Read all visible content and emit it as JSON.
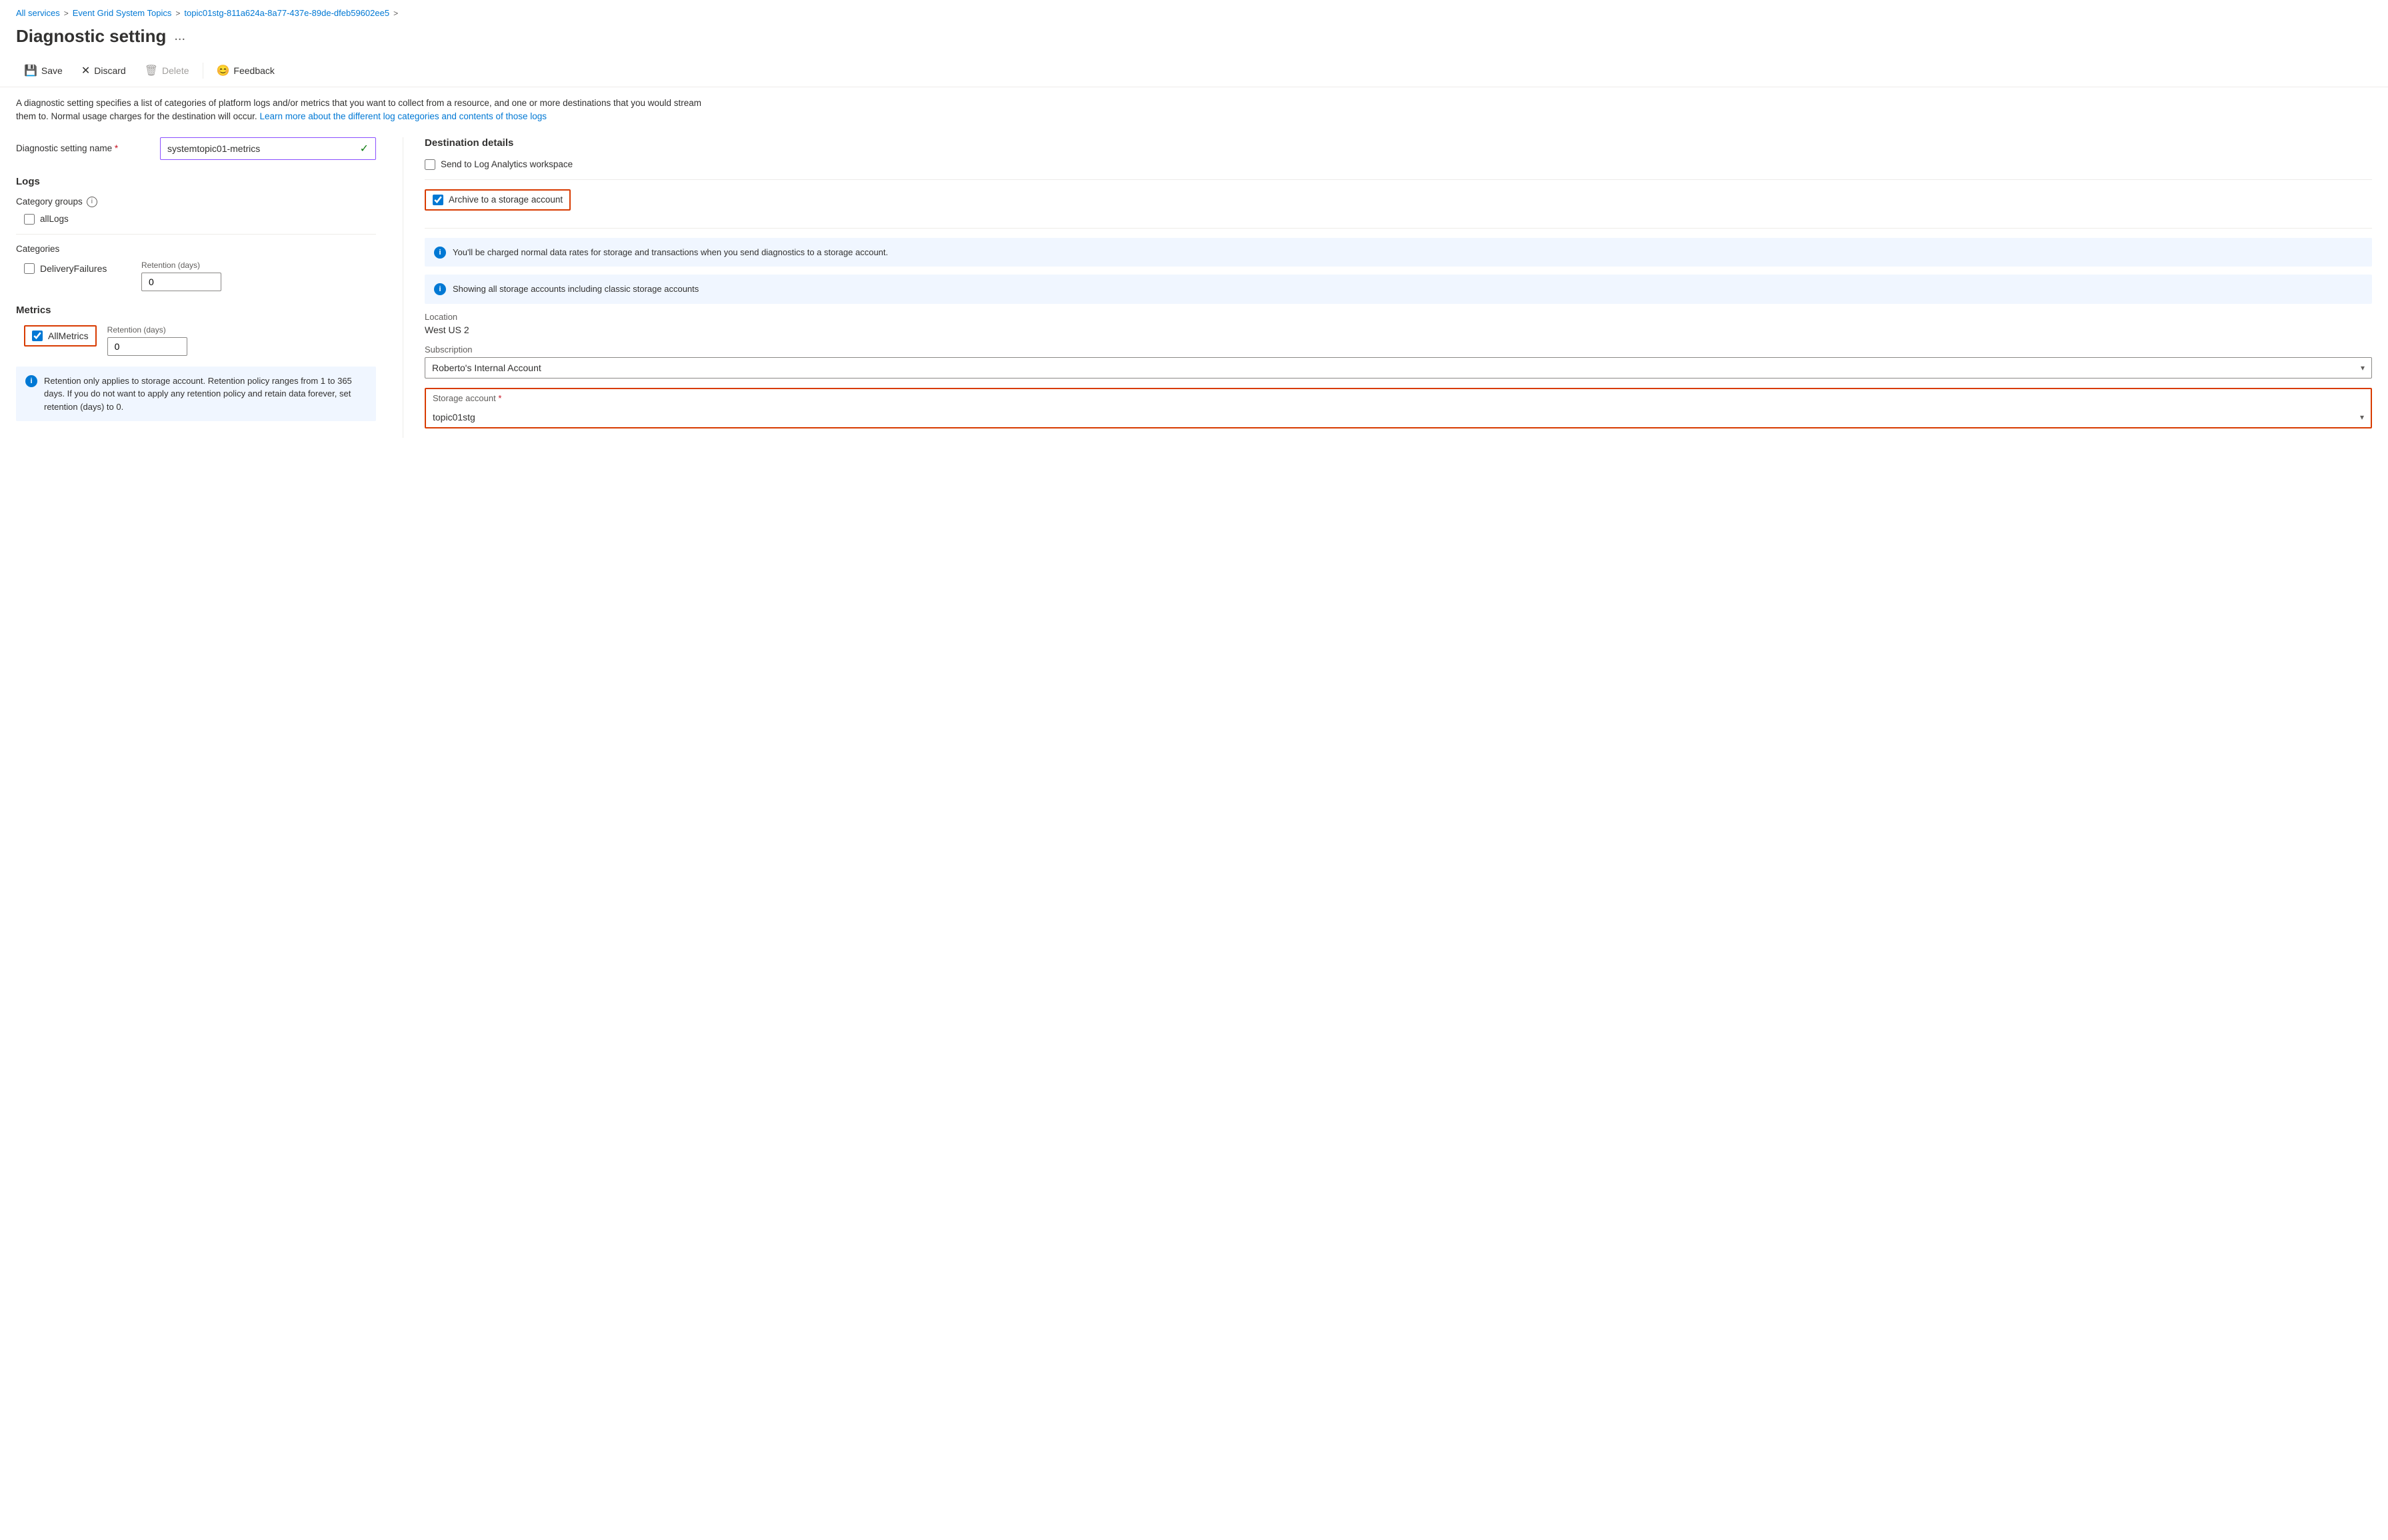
{
  "breadcrumb": {
    "items": [
      {
        "label": "All services",
        "link": true
      },
      {
        "label": "Event Grid System Topics",
        "link": true
      },
      {
        "label": "topic01stg-811a624a-8a77-437e-89de-dfeb59602ee5",
        "link": true
      }
    ],
    "separators": [
      ">",
      ">"
    ]
  },
  "page": {
    "title": "Diagnostic setting",
    "ellipsis": "..."
  },
  "toolbar": {
    "save_label": "Save",
    "discard_label": "Discard",
    "delete_label": "Delete",
    "feedback_label": "Feedback"
  },
  "description": {
    "text": "A diagnostic setting specifies a list of categories of platform logs and/or metrics that you want to collect from a resource, and one or more destinations that you would stream them to. Normal usage charges for the destination will occur.",
    "link_text": "Learn more about the different log categories and contents of those logs"
  },
  "diagnostic_name": {
    "label": "Diagnostic setting name",
    "required": true,
    "value": "systemtopic01-metrics",
    "placeholder": "systemtopic01-metrics"
  },
  "logs": {
    "title": "Logs",
    "category_groups": {
      "label": "Category groups",
      "info": "i",
      "items": [
        {
          "id": "allLogs",
          "label": "allLogs",
          "checked": false
        }
      ]
    },
    "categories": {
      "label": "Categories",
      "items": [
        {
          "id": "deliveryFailures",
          "label": "DeliveryFailures",
          "checked": false,
          "retention_label": "Retention (days)",
          "retention_value": "0"
        }
      ]
    }
  },
  "metrics": {
    "title": "Metrics",
    "items": [
      {
        "id": "allMetrics",
        "label": "AllMetrics",
        "checked": true,
        "retention_label": "Retention (days)",
        "retention_value": "0"
      }
    ]
  },
  "retention_info": {
    "text": "Retention only applies to storage account. Retention policy ranges from 1 to 365 days. If you do not want to apply any retention policy and retain data forever, set retention (days) to 0."
  },
  "destination": {
    "title": "Destination details",
    "log_analytics": {
      "label": "Send to Log Analytics workspace",
      "checked": false
    },
    "archive": {
      "label": "Archive to a storage account",
      "checked": true
    },
    "archive_info1": {
      "text": "You'll be charged normal data rates for storage and transactions when you send diagnostics to a storage account."
    },
    "archive_info2": {
      "text": "Showing all storage accounts including classic storage accounts"
    },
    "location": {
      "label": "Location",
      "value": "West US 2"
    },
    "subscription": {
      "label": "Subscription",
      "value": "Roberto's Internal Account"
    },
    "storage_account": {
      "label": "Storage account",
      "required": true,
      "value": "topic01stg"
    }
  }
}
